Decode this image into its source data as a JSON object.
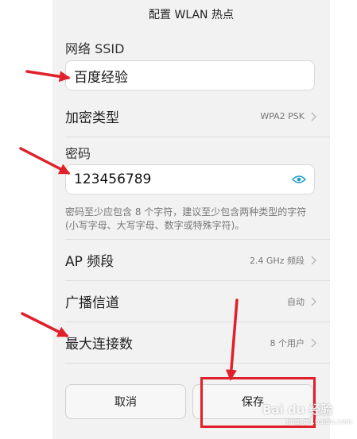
{
  "header": {
    "title": "配置 WLAN 热点"
  },
  "ssid": {
    "label": "网络 SSID",
    "value": "百度经验"
  },
  "security": {
    "label": "加密类型",
    "value": "WPA2 PSK"
  },
  "password": {
    "label": "密码",
    "value": "123456789",
    "hint": "密码至少应包含 8 个字符，建议至少包含两种类型的字符 (小写字母、大写字母、数字或特殊字符)。"
  },
  "ap_band": {
    "label": "AP 频段",
    "value": "2.4 GHz 频段"
  },
  "channel": {
    "label": "广播信道",
    "value": "自动"
  },
  "max_connections": {
    "label": "最大连接数",
    "value": "8 个用户"
  },
  "buttons": {
    "cancel": "取消",
    "save": "保存"
  },
  "annotation": {
    "color": "#e0202a"
  },
  "watermark": {
    "text": "Bai du 经验",
    "sub": "jingyan.baidu.com"
  },
  "colors": {
    "eye_icon": "#1a9bc9",
    "chevron": "#b5b5b5"
  }
}
